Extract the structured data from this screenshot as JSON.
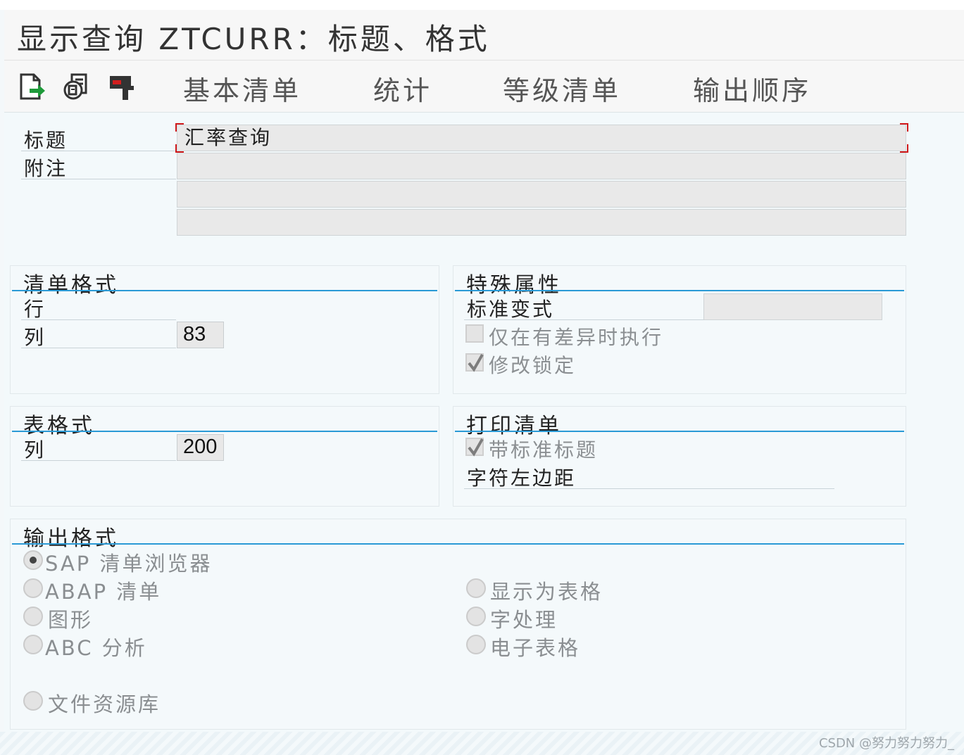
{
  "window": {
    "title": "显示查询 ZTCURR：标题、格式"
  },
  "toolbar": {
    "icons": [
      "export-icon",
      "copy-document-icon",
      "print-format-icon"
    ],
    "menu": [
      "基本清单",
      "统计",
      "等级清单",
      "输出顺序"
    ]
  },
  "header": {
    "title_label": "标题",
    "title_value": "汇率查询",
    "note_label": "附注"
  },
  "list_format": {
    "title": "清单格式",
    "row_label": "行",
    "col_label": "列",
    "col_value": "83"
  },
  "special_attributes": {
    "title": "特殊属性",
    "std_variant_label": "标准变式",
    "only_on_diff_label": "仅在有差异时执行",
    "only_on_diff_checked": false,
    "lock_change_label": "修改锁定",
    "lock_change_checked": true
  },
  "table_format": {
    "title": "表格式",
    "col_label": "列",
    "col_value": "200"
  },
  "print_list": {
    "title": "打印清单",
    "std_header_label": "带标准标题",
    "std_header_checked": true,
    "left_margin_label": "字符左边距"
  },
  "output_format": {
    "title": "输出格式",
    "options_left": [
      "SAP 清单浏览器",
      "ABAP 清单",
      "图形",
      "ABC 分析"
    ],
    "options_right": [
      "显示为表格",
      "字处理",
      "电子表格"
    ],
    "option_bottom": "文件资源库",
    "selected": "SAP 清单浏览器"
  },
  "watermark": "CSDN @努力努力努力_"
}
